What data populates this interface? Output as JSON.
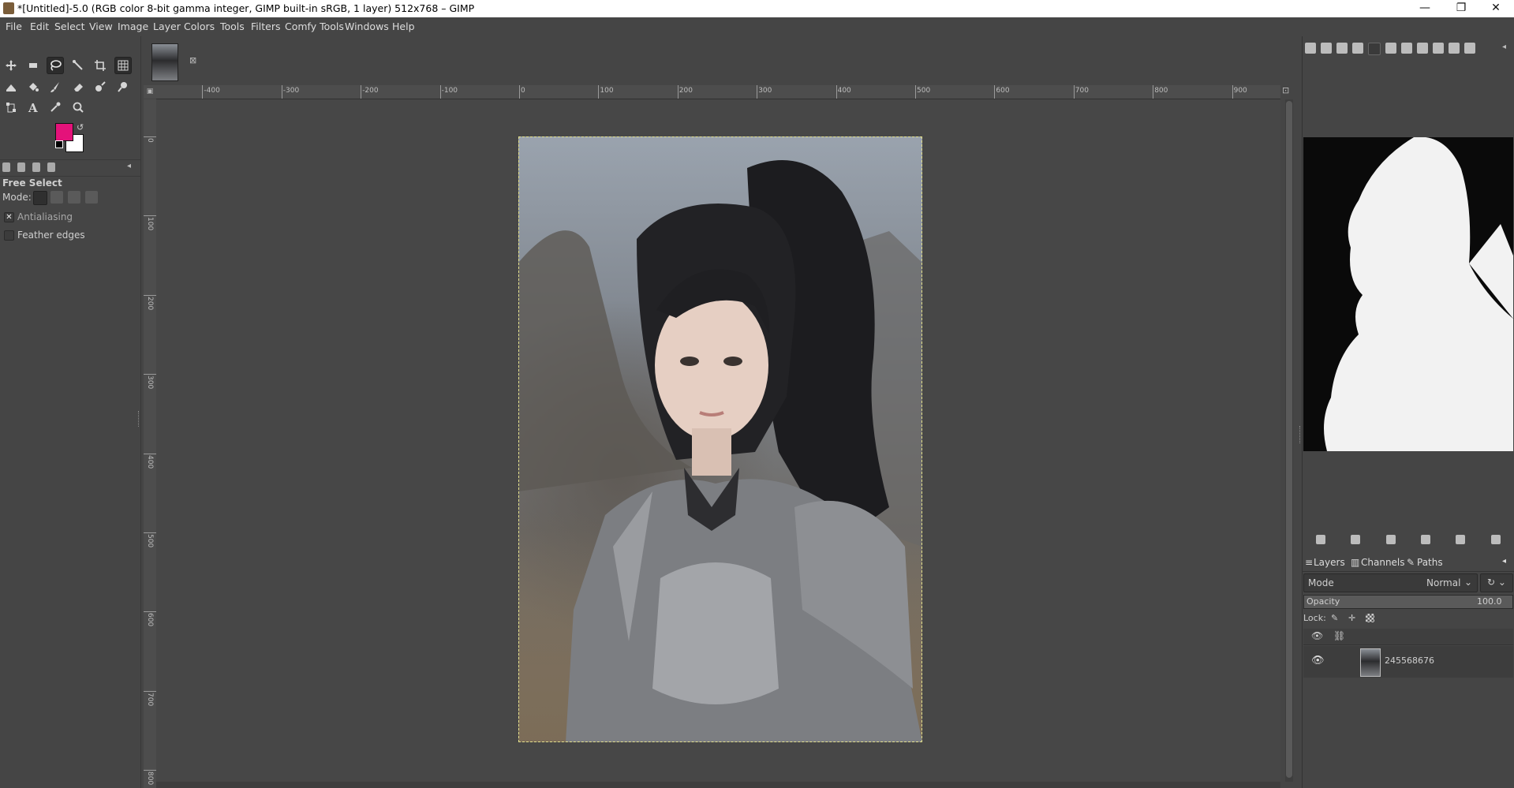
{
  "window": {
    "title": "*[Untitled]-5.0 (RGB color 8-bit gamma integer, GIMP built-in sRGB, 1 layer) 512x768 – GIMP",
    "controls": [
      "—",
      "❐",
      "✕"
    ]
  },
  "menubar": [
    "File",
    "Edit",
    "Select",
    "View",
    "Image",
    "Layer",
    "Colors",
    "Tools",
    "Filters",
    "Comfy Tools",
    "Windows",
    "Help"
  ],
  "toolbox": {
    "tools": [
      "move-tool",
      "rect-select-tool",
      "free-select-tool",
      "fuzzy-select-tool",
      "crop-tool",
      "unified-transform-tool",
      "bucket-fill-tool",
      "paint-tool",
      "pencil-tool",
      "eraser-tool",
      "heal-tool",
      "smudge-tool",
      "paths-tool",
      "text-tool",
      "color-picker-tool",
      "zoom-tool",
      "warp-tool"
    ],
    "active_tool": "free-select-tool",
    "fg_color": "#e4127a",
    "bg_color": "#ffffff"
  },
  "tool_options": {
    "title": "Free Select",
    "mode_label": "Mode:",
    "antialiasing_label": "Antialiasing",
    "antialiasing_checked": true,
    "feather_label": "Feather edges",
    "feather_checked": false
  },
  "rulers": {
    "horizontal": [
      "-400",
      "-300",
      "-200",
      "-100",
      "0",
      "100",
      "200",
      "300",
      "400",
      "500",
      "600",
      "700",
      "800",
      "900"
    ],
    "vertical": [
      "0",
      "100",
      "200",
      "300",
      "400",
      "500",
      "600",
      "700",
      "800"
    ]
  },
  "layers_panel": {
    "tabs": [
      "Layers",
      "Channels",
      "Paths"
    ],
    "mode_label": "Mode",
    "mode_value": "Normal",
    "opacity_label": "Opacity",
    "opacity_value": "100.0",
    "lock_label": "Lock:",
    "layers": [
      {
        "name": "245568676",
        "visible": true
      }
    ]
  }
}
